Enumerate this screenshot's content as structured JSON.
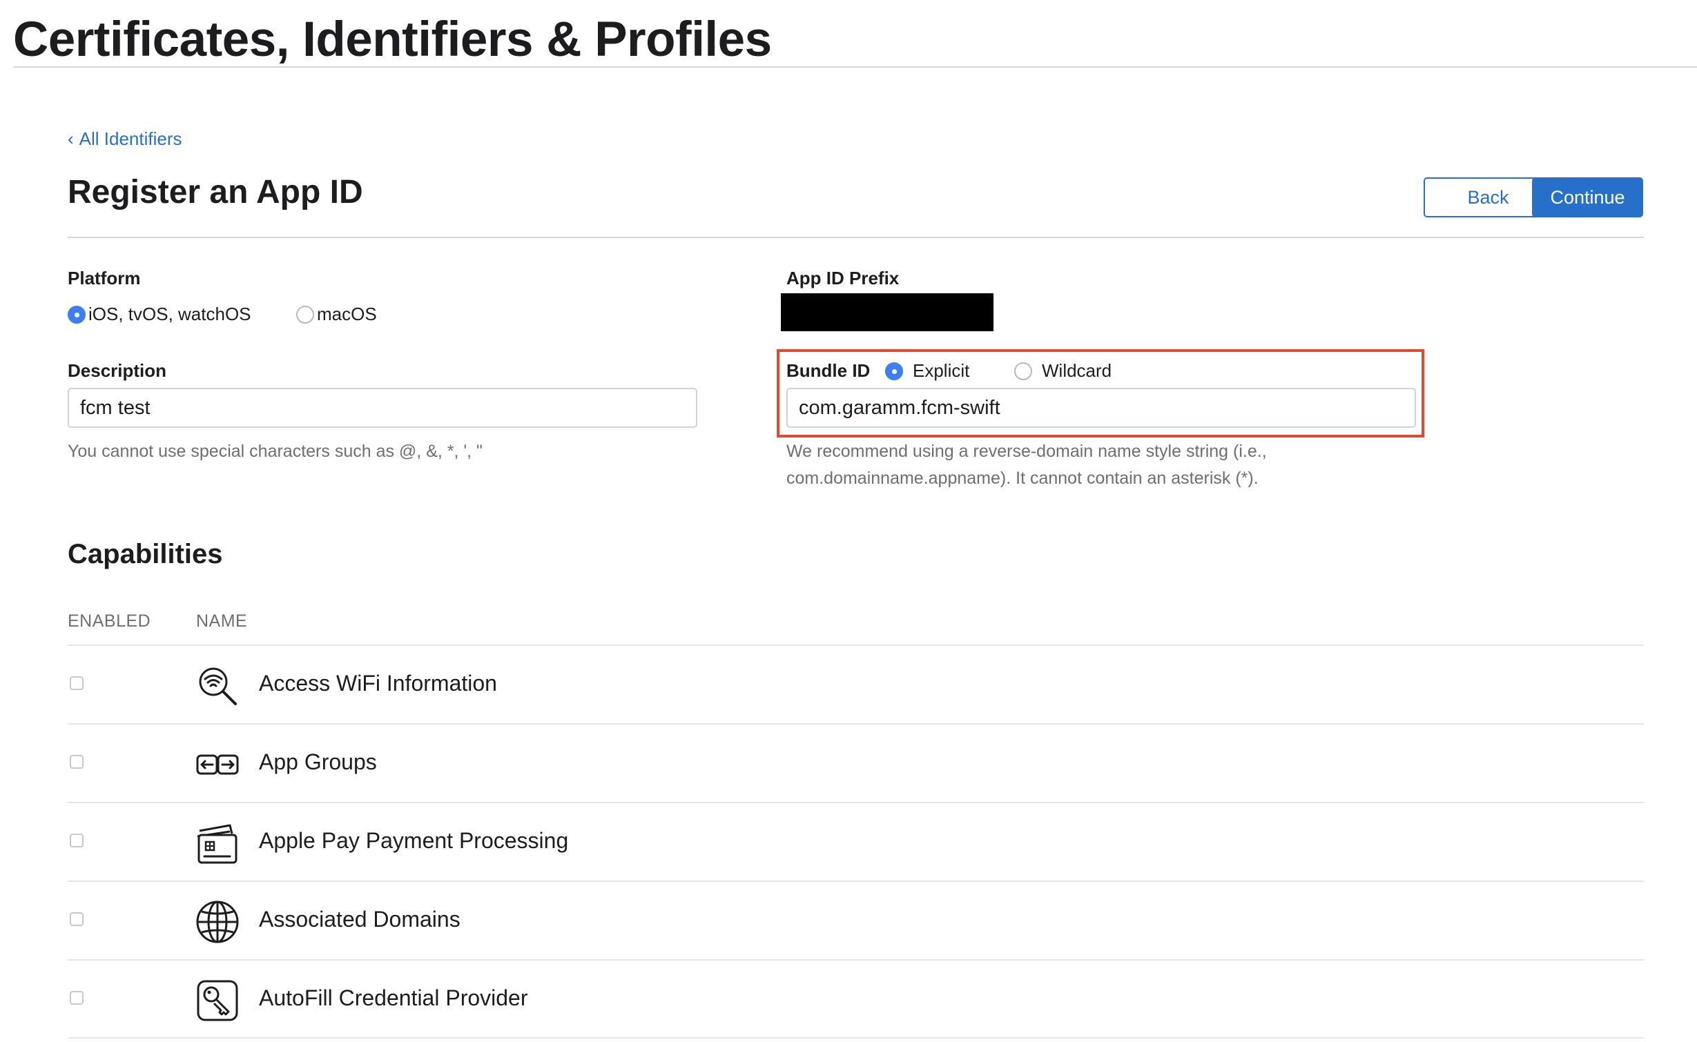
{
  "header": {
    "title": "Certificates, Identifiers & Profiles"
  },
  "nav": {
    "back_chevron": "‹",
    "back_link": "All Identifiers"
  },
  "page": {
    "title": "Register an App ID"
  },
  "actions": {
    "back_label": "Back",
    "continue_label": "Continue"
  },
  "platform": {
    "label": "Platform",
    "options": [
      {
        "label": "iOS, tvOS, watchOS",
        "selected": true
      },
      {
        "label": "macOS",
        "selected": false
      }
    ]
  },
  "prefix": {
    "label": "App ID Prefix"
  },
  "description": {
    "label": "Description",
    "value": "fcm test",
    "hint": "You cannot use special characters such as @, &, *, ', \""
  },
  "bundle": {
    "label": "Bundle ID",
    "options": [
      {
        "label": "Explicit",
        "selected": true
      },
      {
        "label": "Wildcard",
        "selected": false
      }
    ],
    "value": "com.garamm.fcm-swift",
    "hint_line1": "We recommend using a reverse-domain name style string (i.e.,",
    "hint_line2": "com.domainname.appname). It cannot contain an asterisk (*)."
  },
  "capabilities": {
    "title": "Capabilities",
    "columns": [
      "ENABLED",
      "NAME"
    ],
    "items": [
      {
        "name": "Access WiFi Information",
        "icon": "wifi-search-icon",
        "enabled": false
      },
      {
        "name": "App Groups",
        "icon": "app-groups-icon",
        "enabled": false
      },
      {
        "name": "Apple Pay Payment Processing",
        "icon": "payment-card-icon",
        "enabled": false
      },
      {
        "name": "Associated Domains",
        "icon": "globe-icon",
        "enabled": false
      },
      {
        "name": "AutoFill Credential Provider",
        "icon": "key-icon",
        "enabled": false
      }
    ]
  },
  "colors": {
    "accent": "#2670c9",
    "radio_selected": "#3d7ff2",
    "highlight": "#e24a30"
  }
}
